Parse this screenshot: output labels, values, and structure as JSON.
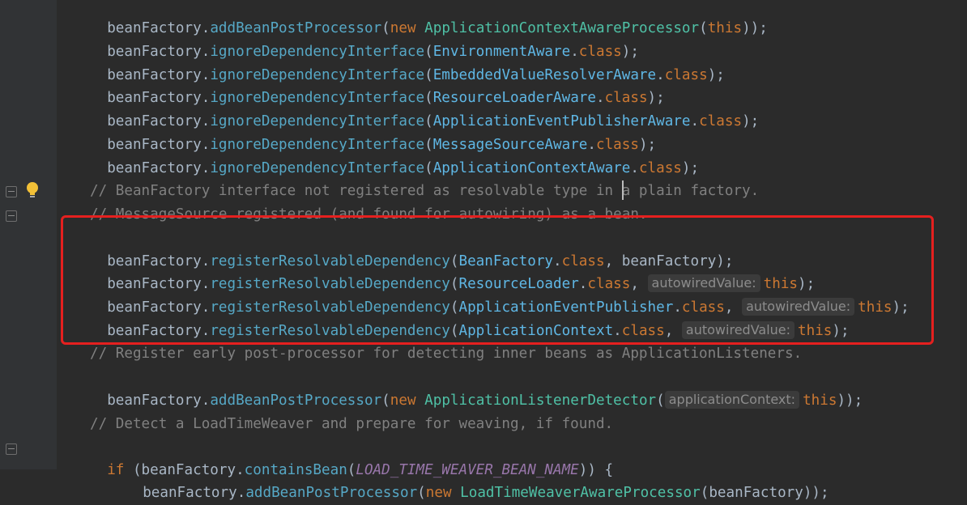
{
  "editor": {
    "lines": {
      "l1": {
        "a": "beanFactory",
        "b": ".",
        "c": "addBeanPostProcessor",
        "d": "(",
        "e": "new",
        "f": " ",
        "g": "ApplicationContextAwareProcessor",
        "h": "(",
        "i": "this",
        "j": "));"
      },
      "l2": {
        "a": "beanFactory",
        "b": ".",
        "c": "ignoreDependencyInterface",
        "d": "(",
        "e": "EnvironmentAware",
        "f": ".",
        "g": "class",
        "h": ");"
      },
      "l3": {
        "a": "beanFactory",
        "b": ".",
        "c": "ignoreDependencyInterface",
        "d": "(",
        "e": "EmbeddedValueResolverAware",
        "f": ".",
        "g": "class",
        "h": ");"
      },
      "l4": {
        "a": "beanFactory",
        "b": ".",
        "c": "ignoreDependencyInterface",
        "d": "(",
        "e": "ResourceLoaderAware",
        "f": ".",
        "g": "class",
        "h": ");"
      },
      "l5": {
        "a": "beanFactory",
        "b": ".",
        "c": "ignoreDependencyInterface",
        "d": "(",
        "e": "ApplicationEventPublisherAware",
        "f": ".",
        "g": "class",
        "h": ");"
      },
      "l6": {
        "a": "beanFactory",
        "b": ".",
        "c": "ignoreDependencyInterface",
        "d": "(",
        "e": "MessageSourceAware",
        "f": ".",
        "g": "class",
        "h": ");"
      },
      "l7": {
        "a": "beanFactory",
        "b": ".",
        "c": "ignoreDependencyInterface",
        "d": "(",
        "e": "ApplicationContextAware",
        "f": ".",
        "g": "class",
        "h": ");"
      },
      "c1": "// BeanFactory interface not registered as resolvable type in a plain factory.",
      "c2": "// MessageSource registered (and found for autowiring) as a bean.",
      "r1": {
        "a": "beanFactory",
        "b": ".",
        "c": "registerResolvableDependency",
        "d": "(",
        "e": "BeanFactory",
        "f": ".",
        "g": "class",
        "h": ", beanFactory);"
      },
      "r2": {
        "a": "beanFactory",
        "b": ".",
        "c": "registerResolvableDependency",
        "d": "(",
        "e": "ResourceLoader",
        "f": ".",
        "g": "class",
        "h": ", ",
        "hint": "autowiredValue:",
        "i": "this",
        "j": ");"
      },
      "r3": {
        "a": "beanFactory",
        "b": ".",
        "c": "registerResolvableDependency",
        "d": "(",
        "e": "ApplicationEventPublisher",
        "f": ".",
        "g": "class",
        "h": ", ",
        "hint": "autowiredValue:",
        "i": "this",
        "j": ");"
      },
      "r4": {
        "a": "beanFactory",
        "b": ".",
        "c": "registerResolvableDependency",
        "d": "(",
        "e": "ApplicationContext",
        "f": ".",
        "g": "class",
        "h": ", ",
        "hint": "autowiredValue:",
        "i": "this",
        "j": ");"
      },
      "c3": "// Register early post-processor for detecting inner beans as ApplicationListeners.",
      "p1": {
        "a": "beanFactory",
        "b": ".",
        "c": "addBeanPostProcessor",
        "d": "(",
        "e": "new",
        "f": " ",
        "g": "ApplicationListenerDetector",
        "h": "(",
        "hint": "applicationContext:",
        "i": "this",
        "j": "));"
      },
      "c4": "// Detect a LoadTimeWeaver and prepare for weaving, if found.",
      "if1": {
        "a": "if",
        "b": " (beanFactory",
        "c": ".",
        "d": "containsBean",
        "e": "(",
        "f": "LOAD_TIME_WEAVER_BEAN_NAME",
        "g": ")) {"
      },
      "p2": {
        "a": "beanFactory",
        "b": ".",
        "c": "addBeanPostProcessor",
        "d": "(",
        "e": "new",
        "f": " ",
        "g": "LoadTimeWeaverAwareProcessor",
        "h": "(beanFactory));"
      }
    }
  },
  "colors": {
    "background": "#2b2b2b",
    "highlight_box": "#e5201f",
    "keyword": "#cc7832",
    "method": "#56a8c6",
    "comment": "#808080"
  }
}
